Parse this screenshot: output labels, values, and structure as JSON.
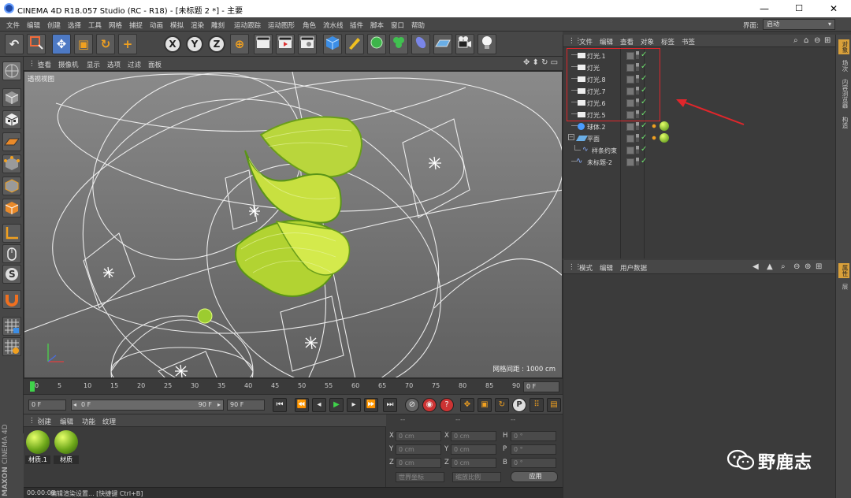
{
  "window": {
    "title": "CINEMA 4D R18.057 Studio (RC - R18) - [未标题 2 *] - 主要",
    "minimize": "—",
    "maximize": "☐",
    "close": "✕"
  },
  "menu": [
    "文件",
    "编辑",
    "创建",
    "选择",
    "工具",
    "网格",
    "捕捉",
    "动画",
    "模拟",
    "渲染",
    "雕刻",
    "运动跟踪",
    "运动图形",
    "角色",
    "流水线",
    "插件",
    "脚本",
    "窗口",
    "帮助"
  ],
  "layout": {
    "label": "界面:",
    "value": "启动"
  },
  "toolbar": {
    "undo": "↶",
    "move": "✥",
    "scale": "▣",
    "rotate": "↻",
    "add": "+",
    "x": "X",
    "y": "Y",
    "z": "Z",
    "coord": "⊕"
  },
  "viewport": {
    "menu": [
      "查看",
      "摄像机",
      "显示",
      "选项",
      "过滤",
      "面板"
    ],
    "label": "透视视图",
    "grid": "网格间距 : 1000 cm"
  },
  "timeline": {
    "ticks": [
      "0",
      "5",
      "10",
      "15",
      "20",
      "25",
      "30",
      "35",
      "40",
      "45",
      "50",
      "55",
      "60",
      "65",
      "70",
      "75",
      "80",
      "85",
      "90"
    ],
    "current": "0 F"
  },
  "transport": {
    "start": "0 F",
    "range_start": "0 F",
    "range_end": "90 F",
    "end": "90 F"
  },
  "materials": {
    "menu": [
      "创建",
      "编辑",
      "功能",
      "纹理"
    ],
    "items": [
      {
        "name": "材质.1"
      },
      {
        "name": "材质"
      }
    ]
  },
  "coords": {
    "header": [
      "--",
      "--",
      "--"
    ],
    "rows": [
      {
        "a": "X",
        "av": "0 cm",
        "b": "X",
        "bv": "0 cm",
        "c": "H",
        "cv": "0 °"
      },
      {
        "a": "Y",
        "av": "0 cm",
        "b": "Y",
        "bv": "0 cm",
        "c": "P",
        "cv": "0 °"
      },
      {
        "a": "Z",
        "av": "0 cm",
        "b": "Z",
        "bv": "0 cm",
        "c": "B",
        "cv": "0 °"
      }
    ],
    "world": "世界坐标",
    "scale": "缩放比例",
    "apply": "应用"
  },
  "status": {
    "time": "00:00:09",
    "text": "编辑渲染设置... [快捷键 Ctrl+B]"
  },
  "maxon": {
    "brand": "MAXON",
    "product": "CINEMA 4D"
  },
  "objects": {
    "menu": [
      "文件",
      "编辑",
      "查看",
      "对象",
      "标签",
      "书签"
    ],
    "items": [
      {
        "name": "灯光.1"
      },
      {
        "name": "灯光"
      },
      {
        "name": "灯光.8"
      },
      {
        "name": "灯光.7"
      },
      {
        "name": "灯光.6"
      },
      {
        "name": "灯光.5"
      },
      {
        "name": "球体.2"
      },
      {
        "name": "平面"
      },
      {
        "name": "样条约束"
      },
      {
        "name": "未标题-2"
      }
    ]
  },
  "attributes": {
    "menu": [
      "模式",
      "编辑",
      "用户数据"
    ]
  },
  "sidetabs": [
    "对象",
    "场次",
    "内容浏览器",
    "构造",
    "属性",
    "层"
  ],
  "watermark": "野鹿志",
  "colors": {
    "highlight": "#e0262b",
    "accent_tab": "#d9a03a"
  }
}
